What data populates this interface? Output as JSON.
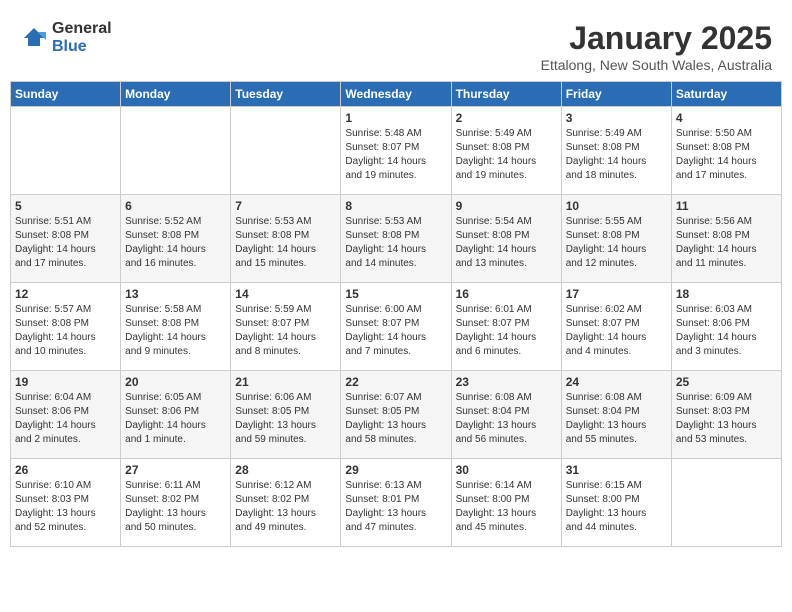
{
  "header": {
    "logo_general": "General",
    "logo_blue": "Blue",
    "title": "January 2025",
    "location": "Ettalong, New South Wales, Australia"
  },
  "weekdays": [
    "Sunday",
    "Monday",
    "Tuesday",
    "Wednesday",
    "Thursday",
    "Friday",
    "Saturday"
  ],
  "weeks": [
    [
      {
        "day": "",
        "info": ""
      },
      {
        "day": "",
        "info": ""
      },
      {
        "day": "",
        "info": ""
      },
      {
        "day": "1",
        "info": "Sunrise: 5:48 AM\nSunset: 8:07 PM\nDaylight: 14 hours\nand 19 minutes."
      },
      {
        "day": "2",
        "info": "Sunrise: 5:49 AM\nSunset: 8:08 PM\nDaylight: 14 hours\nand 19 minutes."
      },
      {
        "day": "3",
        "info": "Sunrise: 5:49 AM\nSunset: 8:08 PM\nDaylight: 14 hours\nand 18 minutes."
      },
      {
        "day": "4",
        "info": "Sunrise: 5:50 AM\nSunset: 8:08 PM\nDaylight: 14 hours\nand 17 minutes."
      }
    ],
    [
      {
        "day": "5",
        "info": "Sunrise: 5:51 AM\nSunset: 8:08 PM\nDaylight: 14 hours\nand 17 minutes."
      },
      {
        "day": "6",
        "info": "Sunrise: 5:52 AM\nSunset: 8:08 PM\nDaylight: 14 hours\nand 16 minutes."
      },
      {
        "day": "7",
        "info": "Sunrise: 5:53 AM\nSunset: 8:08 PM\nDaylight: 14 hours\nand 15 minutes."
      },
      {
        "day": "8",
        "info": "Sunrise: 5:53 AM\nSunset: 8:08 PM\nDaylight: 14 hours\nand 14 minutes."
      },
      {
        "day": "9",
        "info": "Sunrise: 5:54 AM\nSunset: 8:08 PM\nDaylight: 14 hours\nand 13 minutes."
      },
      {
        "day": "10",
        "info": "Sunrise: 5:55 AM\nSunset: 8:08 PM\nDaylight: 14 hours\nand 12 minutes."
      },
      {
        "day": "11",
        "info": "Sunrise: 5:56 AM\nSunset: 8:08 PM\nDaylight: 14 hours\nand 11 minutes."
      }
    ],
    [
      {
        "day": "12",
        "info": "Sunrise: 5:57 AM\nSunset: 8:08 PM\nDaylight: 14 hours\nand 10 minutes."
      },
      {
        "day": "13",
        "info": "Sunrise: 5:58 AM\nSunset: 8:08 PM\nDaylight: 14 hours\nand 9 minutes."
      },
      {
        "day": "14",
        "info": "Sunrise: 5:59 AM\nSunset: 8:07 PM\nDaylight: 14 hours\nand 8 minutes."
      },
      {
        "day": "15",
        "info": "Sunrise: 6:00 AM\nSunset: 8:07 PM\nDaylight: 14 hours\nand 7 minutes."
      },
      {
        "day": "16",
        "info": "Sunrise: 6:01 AM\nSunset: 8:07 PM\nDaylight: 14 hours\nand 6 minutes."
      },
      {
        "day": "17",
        "info": "Sunrise: 6:02 AM\nSunset: 8:07 PM\nDaylight: 14 hours\nand 4 minutes."
      },
      {
        "day": "18",
        "info": "Sunrise: 6:03 AM\nSunset: 8:06 PM\nDaylight: 14 hours\nand 3 minutes."
      }
    ],
    [
      {
        "day": "19",
        "info": "Sunrise: 6:04 AM\nSunset: 8:06 PM\nDaylight: 14 hours\nand 2 minutes."
      },
      {
        "day": "20",
        "info": "Sunrise: 6:05 AM\nSunset: 8:06 PM\nDaylight: 14 hours\nand 1 minute."
      },
      {
        "day": "21",
        "info": "Sunrise: 6:06 AM\nSunset: 8:05 PM\nDaylight: 13 hours\nand 59 minutes."
      },
      {
        "day": "22",
        "info": "Sunrise: 6:07 AM\nSunset: 8:05 PM\nDaylight: 13 hours\nand 58 minutes."
      },
      {
        "day": "23",
        "info": "Sunrise: 6:08 AM\nSunset: 8:04 PM\nDaylight: 13 hours\nand 56 minutes."
      },
      {
        "day": "24",
        "info": "Sunrise: 6:08 AM\nSunset: 8:04 PM\nDaylight: 13 hours\nand 55 minutes."
      },
      {
        "day": "25",
        "info": "Sunrise: 6:09 AM\nSunset: 8:03 PM\nDaylight: 13 hours\nand 53 minutes."
      }
    ],
    [
      {
        "day": "26",
        "info": "Sunrise: 6:10 AM\nSunset: 8:03 PM\nDaylight: 13 hours\nand 52 minutes."
      },
      {
        "day": "27",
        "info": "Sunrise: 6:11 AM\nSunset: 8:02 PM\nDaylight: 13 hours\nand 50 minutes."
      },
      {
        "day": "28",
        "info": "Sunrise: 6:12 AM\nSunset: 8:02 PM\nDaylight: 13 hours\nand 49 minutes."
      },
      {
        "day": "29",
        "info": "Sunrise: 6:13 AM\nSunset: 8:01 PM\nDaylight: 13 hours\nand 47 minutes."
      },
      {
        "day": "30",
        "info": "Sunrise: 6:14 AM\nSunset: 8:00 PM\nDaylight: 13 hours\nand 45 minutes."
      },
      {
        "day": "31",
        "info": "Sunrise: 6:15 AM\nSunset: 8:00 PM\nDaylight: 13 hours\nand 44 minutes."
      },
      {
        "day": "",
        "info": ""
      }
    ]
  ]
}
